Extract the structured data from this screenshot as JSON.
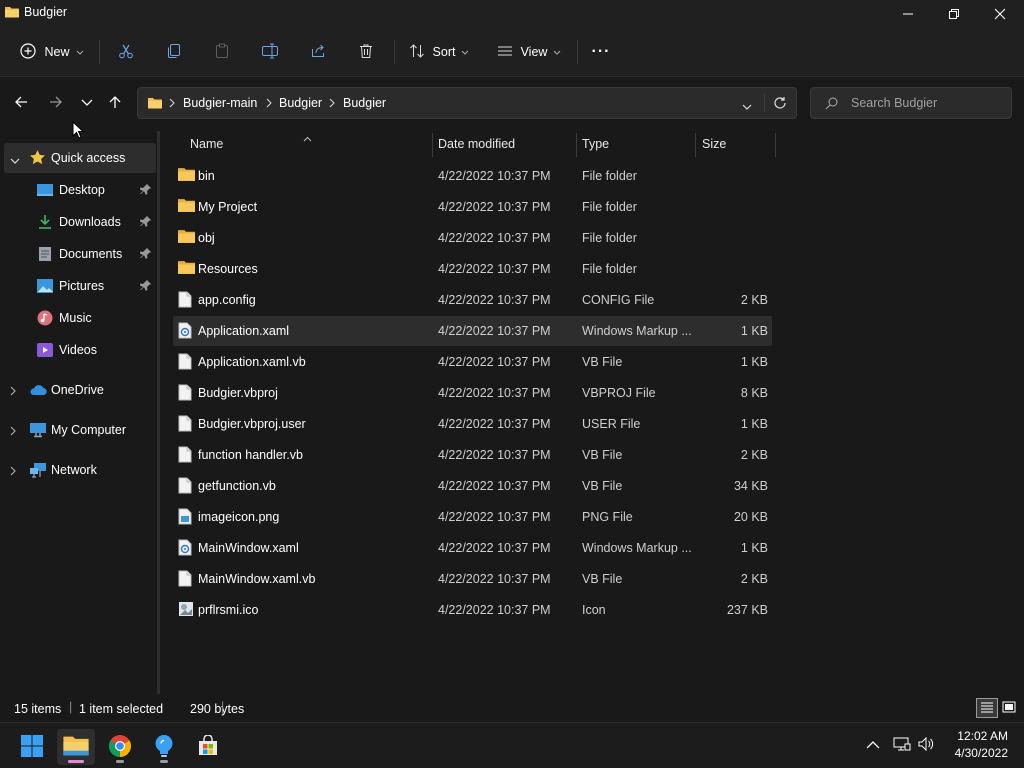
{
  "window": {
    "title": "Budgier"
  },
  "toolbar": {
    "new_label": "New",
    "sort_label": "Sort",
    "view_label": "View",
    "more_label": "···"
  },
  "address": {
    "crumbs": [
      "Budgier-main",
      "Budgier",
      "Budgier"
    ]
  },
  "search": {
    "placeholder": "Search Budgier"
  },
  "sidebar": {
    "quick_access": "Quick access",
    "items": [
      {
        "label": "Desktop",
        "icon": "desktop-icon",
        "pinned": true
      },
      {
        "label": "Downloads",
        "icon": "download-icon",
        "pinned": true
      },
      {
        "label": "Documents",
        "icon": "documents-icon",
        "pinned": true
      },
      {
        "label": "Pictures",
        "icon": "pictures-icon",
        "pinned": true
      },
      {
        "label": "Music",
        "icon": "music-icon",
        "pinned": false
      },
      {
        "label": "Videos",
        "icon": "videos-icon",
        "pinned": false
      }
    ],
    "onedrive": "OneDrive",
    "my_computer": "My Computer",
    "network": "Network"
  },
  "columns": {
    "name": "Name",
    "date": "Date modified",
    "type": "Type",
    "size": "Size"
  },
  "files": [
    {
      "name": "bin",
      "date": "4/22/2022 10:37 PM",
      "type": "File folder",
      "size": "",
      "kind": "folder"
    },
    {
      "name": "My Project",
      "date": "4/22/2022 10:37 PM",
      "type": "File folder",
      "size": "",
      "kind": "folder"
    },
    {
      "name": "obj",
      "date": "4/22/2022 10:37 PM",
      "type": "File folder",
      "size": "",
      "kind": "folder"
    },
    {
      "name": "Resources",
      "date": "4/22/2022 10:37 PM",
      "type": "File folder",
      "size": "",
      "kind": "folder"
    },
    {
      "name": "app.config",
      "date": "4/22/2022 10:37 PM",
      "type": "CONFIG File",
      "size": "2 KB",
      "kind": "file"
    },
    {
      "name": "Application.xaml",
      "date": "4/22/2022 10:37 PM",
      "type": "Windows Markup ...",
      "size": "1 KB",
      "kind": "xaml"
    },
    {
      "name": "Application.xaml.vb",
      "date": "4/22/2022 10:37 PM",
      "type": "VB File",
      "size": "1 KB",
      "kind": "file"
    },
    {
      "name": "Budgier.vbproj",
      "date": "4/22/2022 10:37 PM",
      "type": "VBPROJ File",
      "size": "8 KB",
      "kind": "file"
    },
    {
      "name": "Budgier.vbproj.user",
      "date": "4/22/2022 10:37 PM",
      "type": "USER File",
      "size": "1 KB",
      "kind": "file"
    },
    {
      "name": "function handler.vb",
      "date": "4/22/2022 10:37 PM",
      "type": "VB File",
      "size": "2 KB",
      "kind": "file"
    },
    {
      "name": "getfunction.vb",
      "date": "4/22/2022 10:37 PM",
      "type": "VB File",
      "size": "34 KB",
      "kind": "file"
    },
    {
      "name": "imageicon.png",
      "date": "4/22/2022 10:37 PM",
      "type": "PNG File",
      "size": "20 KB",
      "kind": "png"
    },
    {
      "name": "MainWindow.xaml",
      "date": "4/22/2022 10:37 PM",
      "type": "Windows Markup ...",
      "size": "1 KB",
      "kind": "xaml"
    },
    {
      "name": "MainWindow.xaml.vb",
      "date": "4/22/2022 10:37 PM",
      "type": "VB File",
      "size": "2 KB",
      "kind": "file"
    },
    {
      "name": "prflrsmi.ico",
      "date": "4/22/2022 10:37 PM",
      "type": "Icon",
      "size": "237 KB",
      "kind": "ico"
    }
  ],
  "selected_index": 5,
  "status": {
    "items": "15 items",
    "selection": "1 item selected",
    "bytes": "290 bytes"
  },
  "clock": {
    "time": "12:02 AM",
    "date": "4/30/2022"
  },
  "colors": {
    "folder": "#f2c14e",
    "accent": "#3a96dd",
    "selected_row": "#2d2d2d"
  }
}
